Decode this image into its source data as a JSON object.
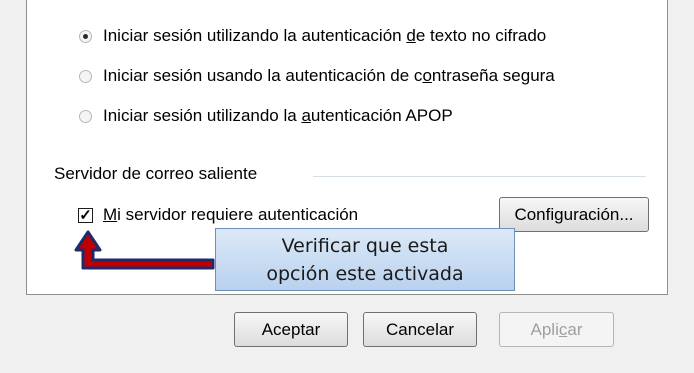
{
  "auth_options": [
    {
      "pre": "Iniciar sesión utilizando la autenticación ",
      "key": "d",
      "post": "e texto no cifrado",
      "checked": true
    },
    {
      "pre": "Iniciar sesión usando la autenticación de c",
      "key": "o",
      "post": "ntraseña segura",
      "checked": false
    },
    {
      "pre": "Iniciar sesión utilizando la ",
      "key": "a",
      "post": "utenticación APOP",
      "checked": false
    }
  ],
  "outgoing": {
    "group_label": "Servidor de correo saliente",
    "requires_auth_key": "M",
    "requires_auth_rest": "i servidor requiere autenticación",
    "requires_auth_checked": true,
    "config_pre": "Confi",
    "config_key": "g",
    "config_post": "uración..."
  },
  "callout": {
    "line1": "Verificar que esta",
    "line2": "opción este activada"
  },
  "buttons": {
    "ok": "Aceptar",
    "cancel": "Cancelar",
    "apply_pre": "Apli",
    "apply_key": "c",
    "apply_post": "ar"
  },
  "colors": {
    "arrow": "#c00000",
    "arrow_outline": "#202a6b"
  }
}
